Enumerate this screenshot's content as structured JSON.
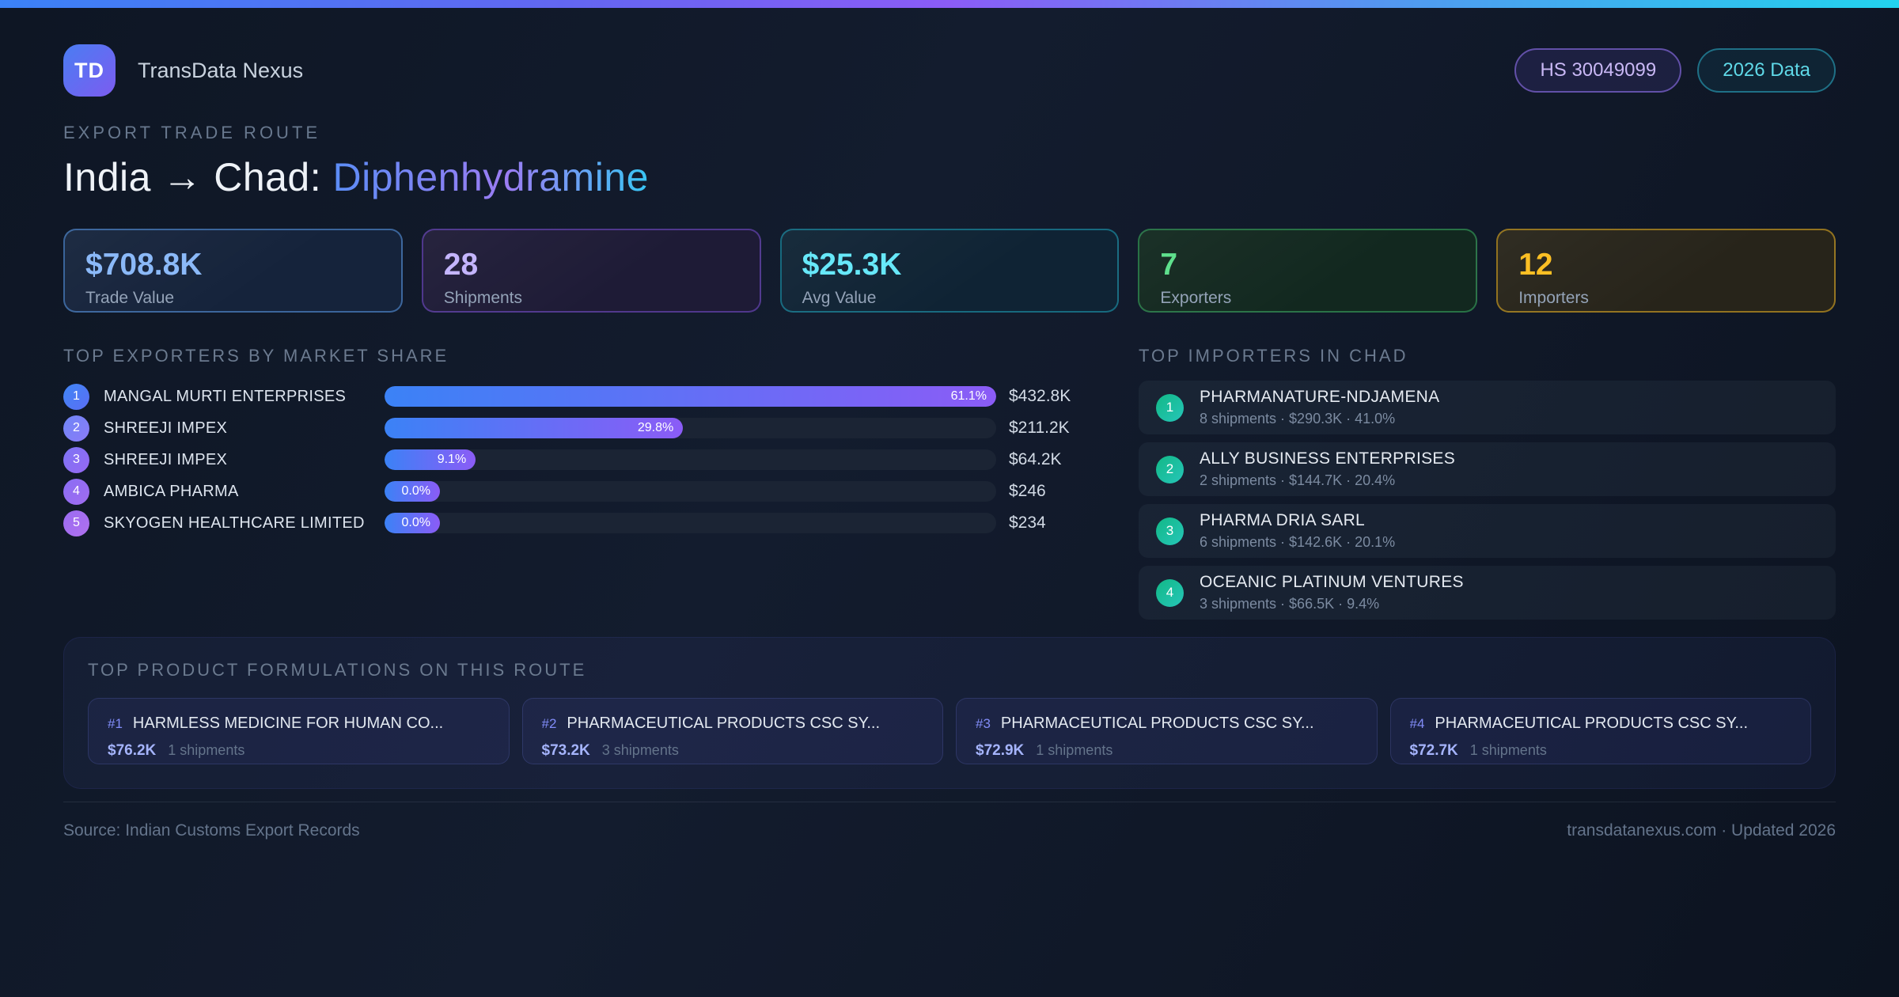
{
  "header": {
    "logo_text": "TD",
    "app_name": "TransData Nexus",
    "hs_badge": "HS 30049099",
    "year_badge": "2026 Data"
  },
  "hero": {
    "eyebrow": "EXPORT TRADE ROUTE",
    "title_prefix": "India → Chad: ",
    "title_highlight": "Diphenhydramine"
  },
  "stats": [
    {
      "value": "$708.8K",
      "label": "Trade Value"
    },
    {
      "value": "28",
      "label": "Shipments"
    },
    {
      "value": "$25.3K",
      "label": "Avg Value"
    },
    {
      "value": "7",
      "label": "Exporters"
    },
    {
      "value": "12",
      "label": "Importers"
    }
  ],
  "exporters": {
    "title": "TOP EXPORTERS BY MARKET SHARE",
    "rows": [
      {
        "rank": "1",
        "name": "MANGAL MURTI ENTERPRISES",
        "share_label": "61.1%",
        "value": "$432.8K",
        "bar_width": "100%"
      },
      {
        "rank": "2",
        "name": "SHREEJI IMPEX",
        "share_label": "29.8%",
        "value": "$211.2K",
        "bar_width": "48.8%"
      },
      {
        "rank": "3",
        "name": "SHREEJI IMPEX",
        "share_label": "9.1%",
        "value": "$64.2K",
        "bar_width": "14.9%"
      },
      {
        "rank": "4",
        "name": "AMBICA PHARMA",
        "share_label": "0.0%",
        "value": "$246",
        "bar_width": "8.5%"
      },
      {
        "rank": "5",
        "name": "SKYOGEN HEALTHCARE LIMITED",
        "share_label": "0.0%",
        "value": "$234",
        "bar_width": "8.5%"
      }
    ]
  },
  "importers": {
    "title": "TOP IMPORTERS IN CHAD",
    "rows": [
      {
        "rank": "1",
        "name": "PHARMANATURE-NDJAMENA",
        "meta": "8 shipments · $290.3K · 41.0%"
      },
      {
        "rank": "2",
        "name": "ALLY BUSINESS ENTERPRISES",
        "meta": "2 shipments · $144.7K · 20.4%"
      },
      {
        "rank": "3",
        "name": "PHARMA DRIA SARL",
        "meta": "6 shipments · $142.6K · 20.1%"
      },
      {
        "rank": "4",
        "name": "OCEANIC PLATINUM VENTURES",
        "meta": "3 shipments · $66.5K · 9.4%"
      }
    ]
  },
  "products": {
    "title": "TOP PRODUCT FORMULATIONS ON THIS ROUTE",
    "cards": [
      {
        "rank": "#1",
        "name": "HARMLESS MEDICINE FOR HUMAN CO...",
        "value": "$76.2K",
        "shipments": "1 shipments"
      },
      {
        "rank": "#2",
        "name": "PHARMACEUTICAL PRODUCTS CSC SY...",
        "value": "$73.2K",
        "shipments": "3 shipments"
      },
      {
        "rank": "#3",
        "name": "PHARMACEUTICAL PRODUCTS CSC SY...",
        "value": "$72.9K",
        "shipments": "1 shipments"
      },
      {
        "rank": "#4",
        "name": "PHARMACEUTICAL PRODUCTS CSC SY...",
        "value": "$72.7K",
        "shipments": "1 shipments"
      }
    ]
  },
  "footer": {
    "source": "Source: Indian Customs Export Records",
    "site": "transdatanexus.com · Updated 2026"
  },
  "colors": {
    "topbar_gradient": [
      "#3b82f6",
      "#8b5cf6",
      "#22d3ee"
    ],
    "stat_blue": "#8bb9f8",
    "stat_purple": "#c4b5fd",
    "stat_cyan": "#67e8f9",
    "stat_green": "#5fe08d",
    "stat_amber": "#fbbf24",
    "bar_gradient": [
      "#3b82f6",
      "#8b5cf6"
    ],
    "importer_badge": [
      "#10b981",
      "#2dd4bf"
    ],
    "background": "#0e1624"
  }
}
